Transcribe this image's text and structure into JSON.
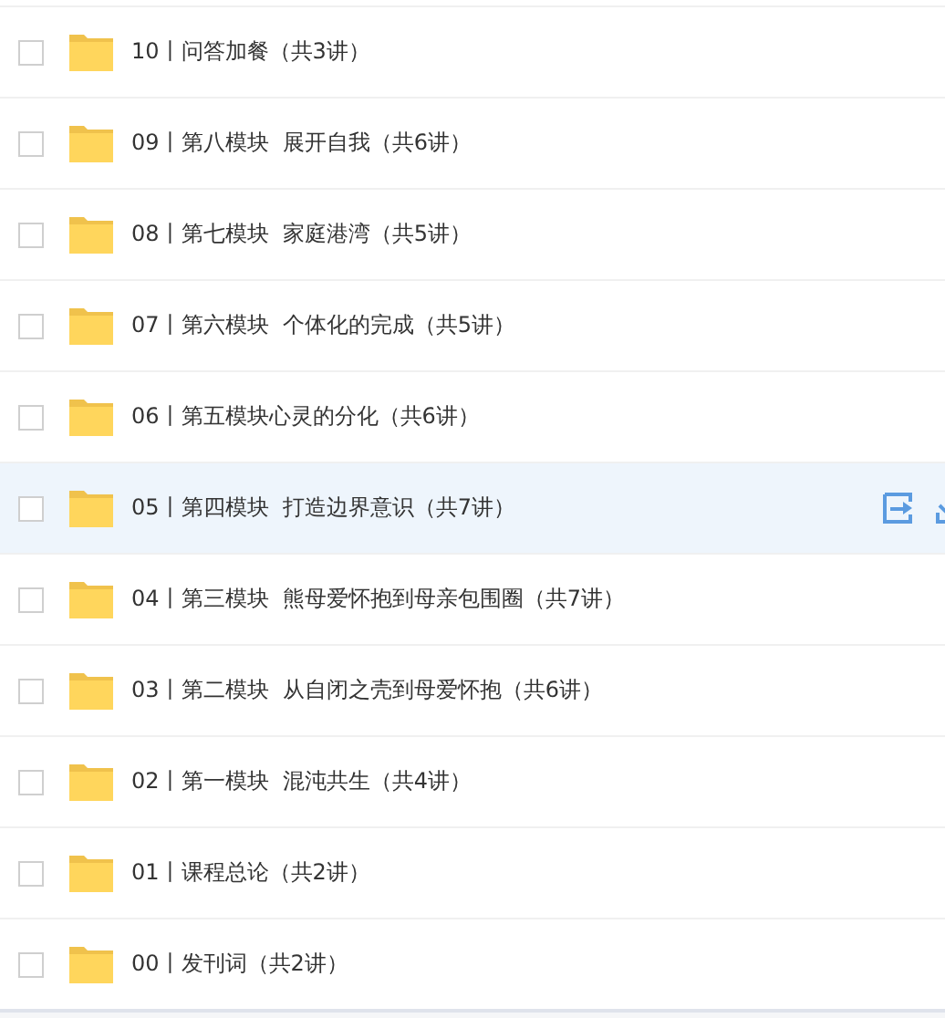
{
  "folders": [
    {
      "name": "10丨问答加餐（共3讲）",
      "checked": false,
      "highlighted": false
    },
    {
      "name": "09丨第八模块  展开自我（共6讲）",
      "checked": false,
      "highlighted": false
    },
    {
      "name": "08丨第七模块  家庭港湾（共5讲）",
      "checked": false,
      "highlighted": false
    },
    {
      "name": "07丨第六模块  个体化的完成（共5讲）",
      "checked": false,
      "highlighted": false
    },
    {
      "name": "06丨第五模块心灵的分化（共6讲）",
      "checked": false,
      "highlighted": false
    },
    {
      "name": "05丨第四模块  打造边界意识（共7讲）",
      "checked": false,
      "highlighted": true
    },
    {
      "name": "04丨第三模块  熊母爱怀抱到母亲包围圈（共7讲）",
      "checked": false,
      "highlighted": false
    },
    {
      "name": "03丨第二模块  从自闭之壳到母爱怀抱（共6讲）",
      "checked": false,
      "highlighted": false
    },
    {
      "name": "02丨第一模块  混沌共生（共4讲）",
      "checked": false,
      "highlighted": false
    },
    {
      "name": "01丨课程总论（共2讲）",
      "checked": false,
      "highlighted": false
    },
    {
      "name": "00丨发刊词（共2讲）",
      "checked": false,
      "highlighted": false
    }
  ]
}
